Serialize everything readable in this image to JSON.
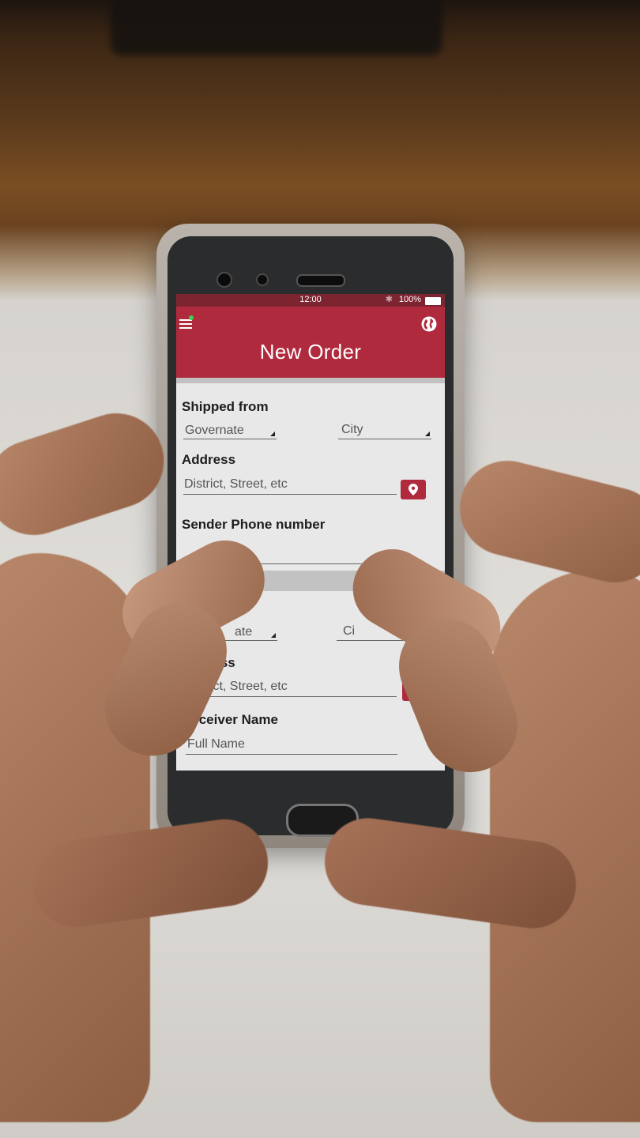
{
  "status_bar": {
    "time": "12:00",
    "battery": "100%"
  },
  "header": {
    "title": "New Order",
    "menu_icon": "hamburger-menu-icon",
    "globe_icon": "globe-icon",
    "accent_color": "#b02a3e"
  },
  "sender": {
    "section_title": "Shipped from",
    "governate_placeholder": "Governate",
    "city_placeholder": "City",
    "address_label": "Address",
    "address_placeholder": "District, Street, etc",
    "phone_label": "Sender Phone number",
    "phone_value": ""
  },
  "receiver": {
    "governate_placeholder_visible": "ate",
    "city_placeholder_visible": "Ci",
    "address_label_visible": "ddress",
    "address_placeholder": "District, Street, etc",
    "name_label": "Receiver Name",
    "name_placeholder": "Full Name"
  }
}
